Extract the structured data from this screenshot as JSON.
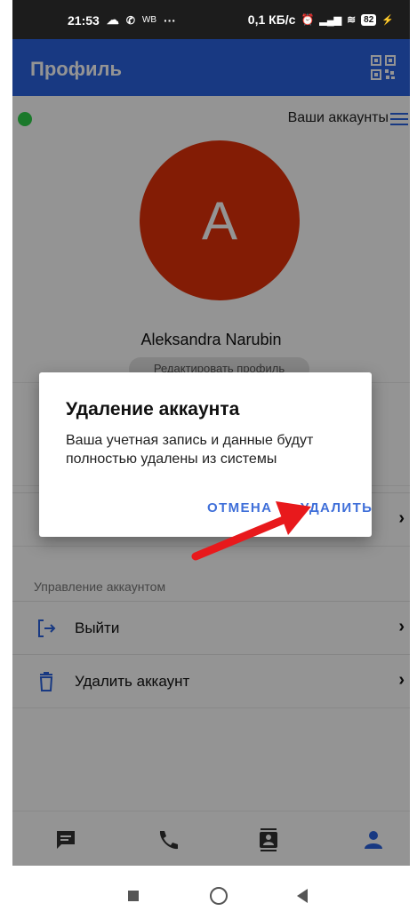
{
  "status_bar": {
    "time": "21:53",
    "left_extra": "WB",
    "left_dots": "···",
    "speed": "0,1 КБ/с",
    "battery": "82"
  },
  "app_bar": {
    "title": "Профиль",
    "qr_icon": "qr-code-icon"
  },
  "profile": {
    "accounts_label": "Ваши аккаунты",
    "avatar_letter": "A",
    "avatar_color": "#e2310a",
    "online_color": "#2fd14a",
    "name": "Aleksandra Narubin",
    "edit_label": "Редактировать профиль"
  },
  "account_section": {
    "title": "Управление аккаунтом",
    "items": [
      {
        "label": "Выйти",
        "icon": "logout-icon"
      },
      {
        "label": "Удалить аккаунт",
        "icon": "trash-icon"
      }
    ]
  },
  "dialog": {
    "title": "Удаление аккаунта",
    "message": "Ваша учетная запись и данные будут полностью удалены из системы",
    "cancel_label": "ОТМЕНА",
    "delete_label": "УДАЛИТЬ",
    "button_color": "#3f6fd9"
  },
  "bottom_nav": {
    "items": [
      "chat-icon",
      "phone-icon",
      "contacts-icon",
      "profile-icon"
    ],
    "active_color": "#2a63e0"
  },
  "annotation": {
    "arrow_color": "#e8191c"
  }
}
